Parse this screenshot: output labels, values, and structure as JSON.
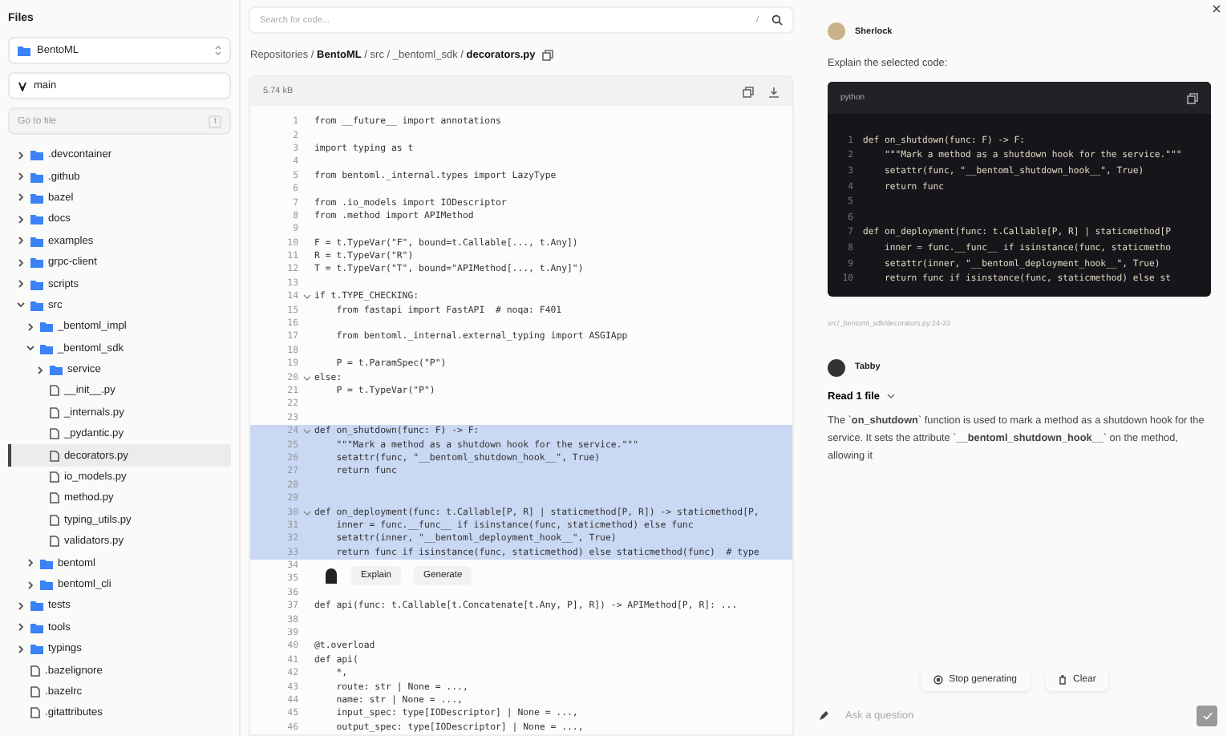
{
  "sidebar": {
    "title": "Files",
    "repo": "BentoML",
    "branch": "main",
    "goto": {
      "placeholder": "Go to file",
      "shortcut": "t"
    },
    "tree": [
      {
        "name": ".devcontainer",
        "kind": "folder",
        "expanded": false,
        "selected": false
      },
      {
        "name": ".github",
        "kind": "folder",
        "expanded": false,
        "selected": false
      },
      {
        "name": "bazel",
        "kind": "folder",
        "expanded": false,
        "selected": false
      },
      {
        "name": "docs",
        "kind": "folder",
        "expanded": false,
        "selected": false
      },
      {
        "name": "examples",
        "kind": "folder",
        "expanded": false,
        "selected": false
      },
      {
        "name": "grpc-client",
        "kind": "folder",
        "expanded": false,
        "selected": false
      },
      {
        "name": "scripts",
        "kind": "folder",
        "expanded": false,
        "selected": false
      },
      {
        "name": "src",
        "kind": "folder",
        "expanded": true,
        "selected": false,
        "children": [
          {
            "name": "_bentoml_impl",
            "kind": "folder",
            "expanded": false,
            "selected": false
          },
          {
            "name": "_bentoml_sdk",
            "kind": "folder",
            "expanded": true,
            "selected": false,
            "children": [
              {
                "name": "service",
                "kind": "folder",
                "expanded": false,
                "selected": false
              },
              {
                "name": "__init__.py",
                "kind": "file",
                "selected": false
              },
              {
                "name": "_internals.py",
                "kind": "file",
                "selected": false
              },
              {
                "name": "_pydantic.py",
                "kind": "file",
                "selected": false
              },
              {
                "name": "decorators.py",
                "kind": "file",
                "selected": true
              },
              {
                "name": "io_models.py",
                "kind": "file",
                "selected": false
              },
              {
                "name": "method.py",
                "kind": "file",
                "selected": false
              },
              {
                "name": "typing_utils.py",
                "kind": "file",
                "selected": false
              },
              {
                "name": "validators.py",
                "kind": "file",
                "selected": false
              }
            ]
          },
          {
            "name": "bentoml",
            "kind": "folder",
            "expanded": false,
            "selected": false
          },
          {
            "name": "bentoml_cli",
            "kind": "folder",
            "expanded": false,
            "selected": false
          }
        ]
      },
      {
        "name": "tests",
        "kind": "folder",
        "expanded": false,
        "selected": false
      },
      {
        "name": "tools",
        "kind": "folder",
        "expanded": false,
        "selected": false
      },
      {
        "name": "typings",
        "kind": "folder",
        "expanded": false,
        "selected": false
      },
      {
        "name": ".bazelignore",
        "kind": "file",
        "selected": false
      },
      {
        "name": ".bazelrc",
        "kind": "file",
        "selected": false
      },
      {
        "name": ".gitattributes",
        "kind": "file",
        "selected": false
      }
    ]
  },
  "search": {
    "placeholder": "Search for code...",
    "shortcut": "/"
  },
  "breadcrumb": "Repositories / **BentoML** / src / _bentoml_sdk / **decorators.py**",
  "file": {
    "size": "5.74 kB",
    "lines": [
      {
        "n": "1",
        "code": "from __future__ import annotations",
        "fold": false,
        "selected": false
      },
      {
        "n": "2",
        "fold": false,
        "selected": false
      },
      {
        "n": "3",
        "code": "import typing as t",
        "fold": false,
        "selected": false
      },
      {
        "n": "4",
        "fold": false,
        "selected": false
      },
      {
        "n": "5",
        "code": "from bentoml._internal.types import LazyType",
        "fold": false,
        "selected": false
      },
      {
        "n": "6",
        "fold": false,
        "selected": false
      },
      {
        "n": "7",
        "code": "from .io_models import IODescriptor",
        "fold": false,
        "selected": false
      },
      {
        "n": "8",
        "code": "from .method import APIMethod",
        "fold": false,
        "selected": false
      },
      {
        "n": "9",
        "fold": false,
        "selected": false
      },
      {
        "n": "10",
        "code": "F = t.TypeVar(\"F\", bound=t.Callable[..., t.Any])",
        "fold": false,
        "selected": false
      },
      {
        "n": "11",
        "code": "R = t.TypeVar(\"R\")",
        "fold": false,
        "selected": false
      },
      {
        "n": "12",
        "code": "T = t.TypeVar(\"T\", bound=\"APIMethod[..., t.Any]\")",
        "fold": false,
        "selected": false
      },
      {
        "n": "13",
        "fold": false,
        "selected": false
      },
      {
        "n": "14",
        "code": "if t.TYPE_CHECKING:",
        "fold": true,
        "selected": false
      },
      {
        "n": "15",
        "code": "    from fastapi import FastAPI  # noqa: F401",
        "fold": false,
        "selected": false
      },
      {
        "n": "16",
        "fold": false,
        "selected": false
      },
      {
        "n": "17",
        "code": "    from bentoml._internal.external_typing import ASGIApp",
        "fold": false,
        "selected": false
      },
      {
        "n": "18",
        "fold": false,
        "selected": false
      },
      {
        "n": "19",
        "code": "    P = t.ParamSpec(\"P\")",
        "fold": false,
        "selected": false
      },
      {
        "n": "20",
        "code": "else:",
        "fold": true,
        "selected": false
      },
      {
        "n": "21",
        "code": "    P = t.TypeVar(\"P\")",
        "fold": false,
        "selected": false
      },
      {
        "n": "22",
        "fold": false,
        "selected": false
      },
      {
        "n": "23",
        "fold": false,
        "selected": false
      },
      {
        "n": "24",
        "code": "def on_shutdown(func: F) -> F:",
        "fold": true,
        "selected": true
      },
      {
        "n": "25",
        "code": "    \"\"\"Mark a method as a shutdown hook for the service.\"\"\"",
        "fold": false,
        "selected": true
      },
      {
        "n": "26",
        "code": "    setattr(func, \"__bentoml_shutdown_hook__\", True)",
        "fold": false,
        "selected": true
      },
      {
        "n": "27",
        "code": "    return func",
        "fold": false,
        "selected": true
      },
      {
        "n": "28",
        "fold": false,
        "selected": true
      },
      {
        "n": "29",
        "fold": false,
        "selected": true
      },
      {
        "n": "30",
        "code": "def on_deployment(func: t.Callable[P, R] | staticmethod[P, R]) -> staticmethod[P,",
        "fold": true,
        "selected": true
      },
      {
        "n": "31",
        "code": "    inner = func.__func__ if isinstance(func, staticmethod) else func",
        "fold": false,
        "selected": true
      },
      {
        "n": "32",
        "code": "    setattr(inner, \"__bentoml_deployment_hook__\", True)",
        "fold": false,
        "selected": true
      },
      {
        "n": "33",
        "code": "    return func if isinstance(func, staticmethod) else staticmethod(func)  # type",
        "fold": false,
        "selected": true
      },
      {
        "n": "34",
        "fold": false,
        "selected": false
      },
      {
        "n": "35",
        "fold": false,
        "selected": false
      },
      {
        "n": "36",
        "fold": false,
        "selected": false
      },
      {
        "n": "37",
        "code": "def api(func: t.Callable[t.Concatenate[t.Any, P], R]) -> APIMethod[P, R]: ...",
        "fold": false,
        "selected": false
      },
      {
        "n": "38",
        "fold": false,
        "selected": false
      },
      {
        "n": "39",
        "fold": false,
        "selected": false
      },
      {
        "n": "40",
        "code": "@t.overload",
        "fold": false,
        "selected": false
      },
      {
        "n": "41",
        "code": "def api(",
        "fold": false,
        "selected": false
      },
      {
        "n": "42",
        "code": "    *,",
        "fold": false,
        "selected": false
      },
      {
        "n": "43",
        "code": "    route: str | None = ...,",
        "fold": false,
        "selected": false
      },
      {
        "n": "44",
        "code": "    name: str | None = ...,",
        "fold": false,
        "selected": false
      },
      {
        "n": "45",
        "code": "    input_spec: type[IODescriptor] | None = ...,",
        "fold": false,
        "selected": false
      },
      {
        "n": "46",
        "code": "    output_spec: type[IODescriptor] | None = ...,",
        "fold": false,
        "selected": false
      }
    ]
  },
  "selection_menu": {
    "buttons": [
      "Explain",
      "Generate"
    ]
  },
  "chat": {
    "messages": [
      {
        "kind": "user",
        "author": "Sherlock",
        "text": "Explain the selected code:",
        "code": {
          "language": "python",
          "lines": [
            {
              "n": "1",
              "code": "def on_shutdown(func: F) -> F:"
            },
            {
              "n": "2",
              "code": "    \"\"\"Mark a method as a shutdown hook for the service.\"\"\""
            },
            {
              "n": "3",
              "code": "    setattr(func, \"__bentoml_shutdown_hook__\", True)"
            },
            {
              "n": "4",
              "code": "    return func"
            },
            {
              "n": "5"
            },
            {
              "n": "6"
            },
            {
              "n": "7",
              "code": "def on_deployment(func: t.Callable[P, R] | staticmethod[P"
            },
            {
              "n": "8",
              "code": "    inner = func.__func__ if isinstance(func, staticmetho"
            },
            {
              "n": "9",
              "code": "    setattr(inner, \"__bentoml_deployment_hook__\", True)"
            },
            {
              "n": "10",
              "code": "    return func if isinstance(func, staticmethod) else st"
            }
          ]
        },
        "reference": "src/_bentoml_sdk/decorators.py:24-33"
      },
      {
        "kind": "assistant",
        "author": "Tabby",
        "context": "Read 1 file",
        "text": "The `**on_shutdown**` function is used to mark a method as a shutdown hook for the service. It sets the attribute `**__bentoml_shutdown_hook__**` on the method, allowing it"
      }
    ],
    "actions": [
      "Stop generating",
      "Clear"
    ],
    "input": {
      "placeholder": "Ask a question"
    }
  }
}
